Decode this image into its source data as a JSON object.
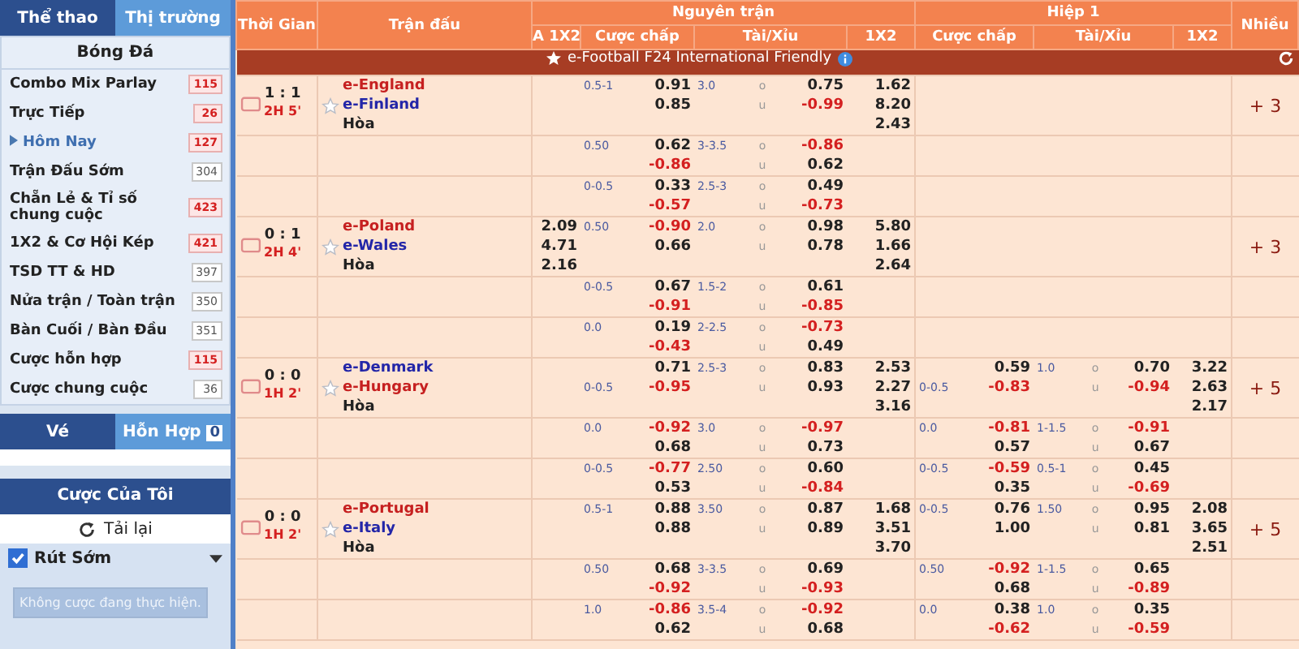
{
  "sidebar": {
    "tabs": [
      {
        "label": "Thể thao",
        "selected": false
      },
      {
        "label": "Thị trường",
        "selected": true
      }
    ],
    "sport": "Bóng Đá",
    "items": [
      {
        "label": "Combo Mix Parlay",
        "count": "115",
        "hot": true,
        "selected": false
      },
      {
        "label": "Trực Tiếp",
        "count": "26",
        "hot": true,
        "selected": false
      },
      {
        "label": "Hôm Nay",
        "count": "127",
        "hot": true,
        "selected": true
      },
      {
        "label": "Trận Đấu Sớm",
        "count": "304",
        "hot": false,
        "selected": false
      },
      {
        "label": "Chẵn Lẻ & Tỉ số chung cuộc",
        "count": "423",
        "hot": true,
        "selected": false
      },
      {
        "label": "1X2 & Cơ Hội Kép",
        "count": "421",
        "hot": true,
        "selected": false
      },
      {
        "label": "TSD TT & HD",
        "count": "397",
        "hot": false,
        "selected": false
      },
      {
        "label": "Nửa trận / Toàn trận",
        "count": "350",
        "hot": false,
        "selected": false
      },
      {
        "label": "Bàn Cuối / Bàn Đầu",
        "count": "351",
        "hot": false,
        "selected": false
      },
      {
        "label": "Cược hỗn hợp",
        "count": "115",
        "hot": true,
        "selected": false
      },
      {
        "label": "Cược chung cuộc",
        "count": "36",
        "hot": false,
        "selected": false
      }
    ],
    "slip_tabs": [
      {
        "label": "Vé",
        "selected": false
      },
      {
        "label": "Hỗn Hợp",
        "count": "0",
        "selected": true
      }
    ],
    "my_bets": {
      "title": "Cược Của Tôi",
      "reload": "Tải lại",
      "cash_out": {
        "label": "Rút Sớm",
        "checked": true
      },
      "empty_button": "Không cược đang thực hiện."
    }
  },
  "table": {
    "headers": {
      "time": "Thời Gian",
      "match": "Trận đấu",
      "full": "Nguyên trận",
      "half": "Hiệp 1",
      "more": "Nhiều",
      "full_cols": [
        "A 1X2",
        "Cược chấp",
        "Tài/Xỉu",
        "1X2"
      ],
      "half_cols": [
        "Cược chấp",
        "Tài/Xỉu",
        "1X2"
      ]
    },
    "league": "e-Football F24 International Friendly",
    "rows": [
      {
        "score": "1 : 1",
        "period": "2H 5'",
        "teams": [
          {
            "name": "e-England",
            "favorite": true
          },
          {
            "name": "e-Finland",
            "favorite": false
          }
        ],
        "draw": "Hòa",
        "hdp": {
          "line": "0.5-1",
          "line_on_away": false,
          "odds": [
            "0.91",
            "0.85"
          ],
          "negative": [
            false,
            false
          ]
        },
        "ou": {
          "line": "3.0",
          "sides": [
            "o",
            "u"
          ],
          "odds": [
            "0.75",
            "-0.99"
          ],
          "negative": [
            false,
            true
          ]
        },
        "x12": [
          "1.62",
          "8.20",
          "2.43"
        ],
        "more": "+ 3"
      },
      {
        "hdp": {
          "line": "0.50",
          "line_on_away": false,
          "odds": [
            "0.62",
            "-0.86"
          ],
          "negative": [
            false,
            true
          ]
        },
        "ou": {
          "line": "3-3.5",
          "sides": [
            "o",
            "u"
          ],
          "odds": [
            "-0.86",
            "0.62"
          ],
          "negative": [
            true,
            false
          ]
        }
      },
      {
        "hdp": {
          "line": "0-0.5",
          "line_on_away": false,
          "odds": [
            "0.33",
            "-0.57"
          ],
          "negative": [
            false,
            true
          ]
        },
        "ou": {
          "line": "2.5-3",
          "sides": [
            "o",
            "u"
          ],
          "odds": [
            "0.49",
            "-0.73"
          ],
          "negative": [
            false,
            true
          ]
        }
      },
      {
        "score": "0 : 1",
        "period": "2H 4'",
        "teams": [
          {
            "name": "e-Poland",
            "favorite": true
          },
          {
            "name": "e-Wales",
            "favorite": false
          }
        ],
        "draw": "Hòa",
        "a1x2": [
          "2.09",
          "4.71",
          "2.16"
        ],
        "hdp": {
          "line": "0.50",
          "line_on_away": false,
          "odds": [
            "-0.90",
            "0.66"
          ],
          "negative": [
            true,
            false
          ]
        },
        "ou": {
          "line": "2.0",
          "sides": [
            "o",
            "u"
          ],
          "odds": [
            "0.98",
            "0.78"
          ],
          "negative": [
            false,
            false
          ]
        },
        "x12": [
          "5.80",
          "1.66",
          "2.64"
        ],
        "more": "+ 3"
      },
      {
        "hdp": {
          "line": "0-0.5",
          "line_on_away": false,
          "odds": [
            "0.67",
            "-0.91"
          ],
          "negative": [
            false,
            true
          ]
        },
        "ou": {
          "line": "1.5-2",
          "sides": [
            "o",
            "u"
          ],
          "odds": [
            "0.61",
            "-0.85"
          ],
          "negative": [
            false,
            true
          ]
        }
      },
      {
        "hdp": {
          "line": "0.0",
          "line_on_away": false,
          "odds": [
            "0.19",
            "-0.43"
          ],
          "negative": [
            false,
            true
          ]
        },
        "ou": {
          "line": "2-2.5",
          "sides": [
            "o",
            "u"
          ],
          "odds": [
            "-0.73",
            "0.49"
          ],
          "negative": [
            true,
            false
          ]
        }
      },
      {
        "score": "0 : 0",
        "period": "1H 2'",
        "teams": [
          {
            "name": "e-Denmark",
            "favorite": false
          },
          {
            "name": "e-Hungary",
            "favorite": true
          }
        ],
        "draw": "Hòa",
        "hdp": {
          "line": "0-0.5",
          "line_on_away": true,
          "odds": [
            "0.71",
            "-0.95"
          ],
          "negative": [
            false,
            true
          ]
        },
        "ou": {
          "line": "2.5-3",
          "sides": [
            "o",
            "u"
          ],
          "odds": [
            "0.83",
            "0.93"
          ],
          "negative": [
            false,
            false
          ]
        },
        "x12": [
          "2.53",
          "2.27",
          "3.16"
        ],
        "h1_hdp": {
          "line": "0-0.5",
          "line_on_away": true,
          "odds": [
            "0.59",
            "-0.83"
          ],
          "negative": [
            false,
            true
          ]
        },
        "h1_ou": {
          "line": "1.0",
          "sides": [
            "o",
            "u"
          ],
          "odds": [
            "0.70",
            "-0.94"
          ],
          "negative": [
            false,
            true
          ]
        },
        "h1_x12": [
          "3.22",
          "2.63",
          "2.17"
        ],
        "more": "+ 5"
      },
      {
        "hdp": {
          "line": "0.0",
          "line_on_away": false,
          "odds": [
            "-0.92",
            "0.68"
          ],
          "negative": [
            true,
            false
          ]
        },
        "ou": {
          "line": "3.0",
          "sides": [
            "o",
            "u"
          ],
          "odds": [
            "-0.97",
            "0.73"
          ],
          "negative": [
            true,
            false
          ]
        },
        "h1_hdp": {
          "line": "0.0",
          "line_on_away": false,
          "odds": [
            "-0.81",
            "0.57"
          ],
          "negative": [
            true,
            false
          ]
        },
        "h1_ou": {
          "line": "1-1.5",
          "sides": [
            "o",
            "u"
          ],
          "odds": [
            "-0.91",
            "0.67"
          ],
          "negative": [
            true,
            false
          ]
        }
      },
      {
        "hdp": {
          "line": "0-0.5",
          "line_on_away": false,
          "odds": [
            "-0.77",
            "0.53"
          ],
          "negative": [
            true,
            false
          ]
        },
        "ou": {
          "line": "2.50",
          "sides": [
            "o",
            "u"
          ],
          "odds": [
            "0.60",
            "-0.84"
          ],
          "negative": [
            false,
            true
          ]
        },
        "h1_hdp": {
          "line": "0-0.5",
          "line_on_away": false,
          "odds": [
            "-0.59",
            "0.35"
          ],
          "negative": [
            true,
            false
          ]
        },
        "h1_ou": {
          "line": "0.5-1",
          "sides": [
            "o",
            "u"
          ],
          "odds": [
            "0.45",
            "-0.69"
          ],
          "negative": [
            false,
            true
          ]
        }
      },
      {
        "score": "0 : 0",
        "period": "1H 2'",
        "teams": [
          {
            "name": "e-Portugal",
            "favorite": true
          },
          {
            "name": "e-Italy",
            "favorite": false
          }
        ],
        "draw": "Hòa",
        "hdp": {
          "line": "0.5-1",
          "line_on_away": false,
          "odds": [
            "0.88",
            "0.88"
          ],
          "negative": [
            false,
            false
          ]
        },
        "ou": {
          "line": "3.50",
          "sides": [
            "o",
            "u"
          ],
          "odds": [
            "0.87",
            "0.89"
          ],
          "negative": [
            false,
            false
          ]
        },
        "x12": [
          "1.68",
          "3.51",
          "3.70"
        ],
        "h1_hdp": {
          "line": "0-0.5",
          "line_on_away": false,
          "odds": [
            "0.76",
            "1.00"
          ],
          "negative": [
            false,
            false
          ]
        },
        "h1_ou": {
          "line": "1.50",
          "sides": [
            "o",
            "u"
          ],
          "odds": [
            "0.95",
            "0.81"
          ],
          "negative": [
            false,
            false
          ]
        },
        "h1_x12": [
          "2.08",
          "3.65",
          "2.51"
        ],
        "more": "+ 5"
      },
      {
        "hdp": {
          "line": "0.50",
          "line_on_away": false,
          "odds": [
            "0.68",
            "-0.92"
          ],
          "negative": [
            false,
            true
          ]
        },
        "ou": {
          "line": "3-3.5",
          "sides": [
            "o",
            "u"
          ],
          "odds": [
            "0.69",
            "-0.93"
          ],
          "negative": [
            false,
            true
          ]
        },
        "h1_hdp": {
          "line": "0.50",
          "line_on_away": false,
          "odds": [
            "-0.92",
            "0.68"
          ],
          "negative": [
            true,
            false
          ]
        },
        "h1_ou": {
          "line": "1-1.5",
          "sides": [
            "o",
            "u"
          ],
          "odds": [
            "0.65",
            "-0.89"
          ],
          "negative": [
            false,
            true
          ]
        }
      },
      {
        "hdp": {
          "line": "1.0",
          "line_on_away": false,
          "odds": [
            "-0.86",
            "0.62"
          ],
          "negative": [
            true,
            false
          ]
        },
        "ou": {
          "line": "3.5-4",
          "sides": [
            "o",
            "u"
          ],
          "odds": [
            "-0.92",
            "0.68"
          ],
          "negative": [
            true,
            false
          ]
        },
        "h1_hdp": {
          "line": "0.0",
          "line_on_away": false,
          "odds": [
            "0.38",
            "-0.62"
          ],
          "negative": [
            false,
            true
          ]
        },
        "h1_ou": {
          "line": "1.0",
          "sides": [
            "o",
            "u"
          ],
          "odds": [
            "0.35",
            "-0.59"
          ],
          "negative": [
            false,
            true
          ]
        }
      }
    ]
  }
}
